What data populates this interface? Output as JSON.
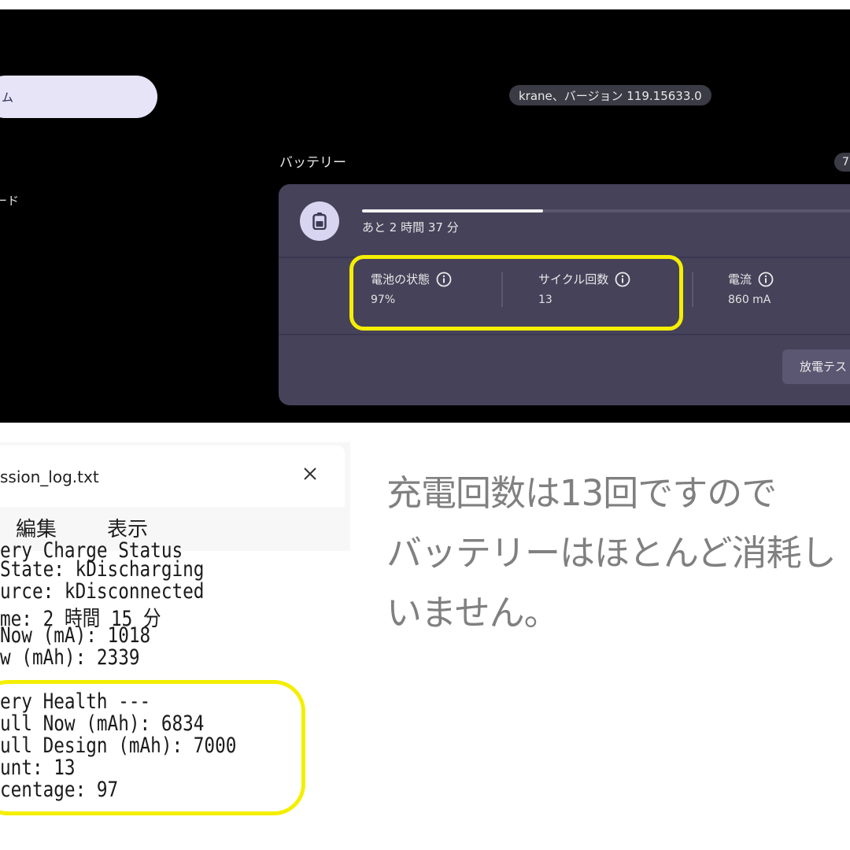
{
  "diagnostics": {
    "nav": {
      "active_item": "ム",
      "second_item": "ード"
    },
    "version_badge": "krane、バージョン 119.15633.0",
    "section_title": "バッテリー",
    "side_badge": "7",
    "battery_card": {
      "icon": "battery-icon",
      "charge_fraction": 0.36,
      "remaining_time": "あと 2 時間 37 分",
      "stats": [
        {
          "label": "電池の状態",
          "value": "97%",
          "icon": "info-icon"
        },
        {
          "label": "サイクル回数",
          "value": "13",
          "icon": "info-icon"
        },
        {
          "label": "電流",
          "value": "860 mA",
          "icon": "info-icon"
        }
      ],
      "discharge_button": "放電テス"
    },
    "highlight_color": "#f4ef00"
  },
  "notepad": {
    "title": "ssion_log.txt",
    "close_icon": "close-icon",
    "menu": [
      "編集",
      "表示"
    ],
    "lines": [
      "ery Charge Status",
      "State: kDischarging",
      "urce: kDisconnected",
      "me: 2 時間 15 分",
      "Now (mA): 1018",
      "w (mAh): 2339",
      "",
      "ery Health ---",
      "ull Now (mAh): 6834",
      "ull Design (mAh): 7000",
      "unt: 13",
      "centage: 97"
    ]
  },
  "caption": {
    "lines": [
      "充電回数は13回ですので",
      "バッテリーはほとんど消耗し",
      "いません。"
    ]
  }
}
